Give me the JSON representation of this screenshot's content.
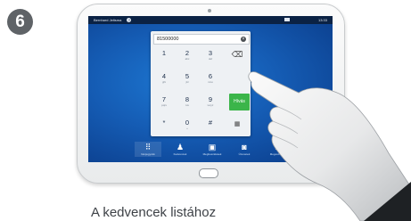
{
  "step_number": "6",
  "screen": {
    "status_bar": {
      "user": "Bernhard Jeltsma",
      "help": "?",
      "time": "13:33"
    },
    "number_field": {
      "value": "81500000"
    },
    "keypad": [
      {
        "digit": "1",
        "letters": ""
      },
      {
        "digit": "2",
        "letters": "abc"
      },
      {
        "digit": "3",
        "letters": "def"
      },
      {
        "digit": "4",
        "letters": "ghi"
      },
      {
        "digit": "5",
        "letters": "jkl"
      },
      {
        "digit": "6",
        "letters": "mno"
      },
      {
        "digit": "7",
        "letters": "pqrs"
      },
      {
        "digit": "8",
        "letters": "tuv"
      },
      {
        "digit": "9",
        "letters": "wxyz"
      },
      {
        "digit": "*",
        "letters": ""
      },
      {
        "digit": "0",
        "letters": "+"
      },
      {
        "digit": "#",
        "letters": ""
      }
    ],
    "call_button_label": "Hívás",
    "more_label": "•••",
    "bottom_nav": [
      {
        "label": "Névjegyzék",
        "icon": "keypad-icon"
      },
      {
        "label": "Kedvencek",
        "icon": "person-icon"
      },
      {
        "label": "Megbeszélések",
        "icon": "calendar-icon"
      },
      {
        "label": "Üzenetek",
        "icon": "voicemail-icon"
      },
      {
        "label": "Megosztás",
        "icon": "share-icon"
      }
    ]
  },
  "caption": "A kedvencek listához"
}
